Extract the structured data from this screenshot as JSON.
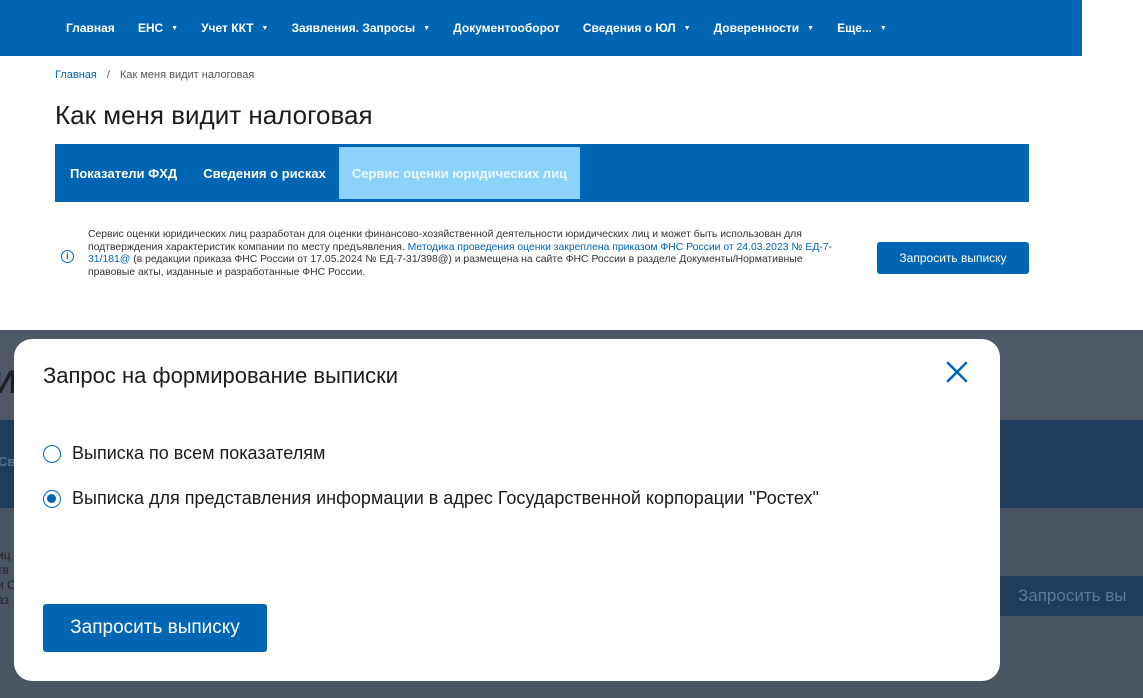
{
  "nav": {
    "items": [
      {
        "label": "Главная",
        "caret": false
      },
      {
        "label": "ЕНС",
        "caret": true
      },
      {
        "label": "Учет ККТ",
        "caret": true
      },
      {
        "label": "Заявления. Запросы",
        "caret": true
      },
      {
        "label": "Документооборот",
        "caret": false
      },
      {
        "label": "Сведения о ЮЛ",
        "caret": true
      },
      {
        "label": "Доверенности",
        "caret": true
      },
      {
        "label": "Еще...",
        "caret": true
      }
    ],
    "caret_glyph": "▼"
  },
  "breadcrumb": {
    "home": "Главная",
    "separator": "/",
    "current": "Как меня видит налоговая"
  },
  "page_title": "Как меня видит налоговая",
  "tabs": [
    {
      "label": "Показатели ФХД",
      "active": false
    },
    {
      "label": "Сведения о рисках",
      "active": false
    },
    {
      "label": "Сервис оценки юридических лиц",
      "active": true
    }
  ],
  "info": {
    "icon": "info-icon",
    "icon_glyph": "i",
    "text_part1": "Сервис оценки юридических лиц разработан для оценки финансово-хозяйственной деятельности юридических лиц и может быть использован для подтверждения характеристик компании по месту предъявления.",
    "link_text": "Методика проведения оценки закреплена приказом ФНС России от 24.03.2023 № ЕД-7-31/181@",
    "text_part2": "(в редакции приказа ФНС России от 17.05.2024 № ЕД-7-31/398@) и размещена на сайте ФНС России в разделе Документы/Нормативные правовые акты, изданные и разработанные ФНС России."
  },
  "request_button_label": "Запросить выписку",
  "background_fragments": {
    "title": "И",
    "tab": "Св",
    "text_lines": [
      "иц",
      "тв",
      "и С",
      "аз"
    ],
    "button": "Запросить вы"
  },
  "modal": {
    "title": "Запрос на формирование выписки",
    "close_icon": "close-icon",
    "options": [
      {
        "label": "Выписка по всем показателям",
        "selected": false
      },
      {
        "label": "Выписка для представления информации в адрес Государственной корпорации \"Ростех\"",
        "selected": true
      }
    ],
    "submit_label": "Запросить выписку"
  },
  "colors": {
    "primary": "#0066b3",
    "active_tab": "#8dd3f9",
    "overlay": "#4a5563"
  }
}
